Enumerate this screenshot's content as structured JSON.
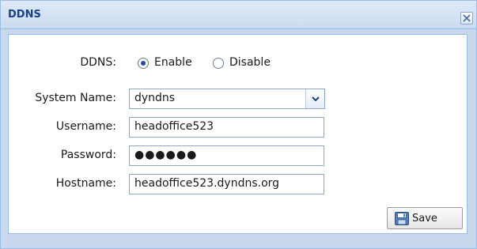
{
  "window": {
    "title": "DDNS",
    "close_icon": "close-icon"
  },
  "form": {
    "ddns": {
      "label": "DDNS:",
      "options": [
        "Enable",
        "Disable"
      ],
      "selected": "Enable"
    },
    "system_name": {
      "label": "System Name:",
      "value": "dyndns",
      "icon": "chevron-down-icon"
    },
    "username": {
      "label": "Username:",
      "value": "headoffice523"
    },
    "password": {
      "label": "Password:",
      "value": "●●●●●●"
    },
    "hostname": {
      "label": "Hostname:",
      "value": "headoffice523.dyndns.org"
    }
  },
  "actions": {
    "save_label": "Save",
    "save_icon": "floppy-disk-icon"
  },
  "colors": {
    "title_text": "#15428b",
    "frame_border": "#99bbe8",
    "field_border": "#8ca8cf"
  }
}
